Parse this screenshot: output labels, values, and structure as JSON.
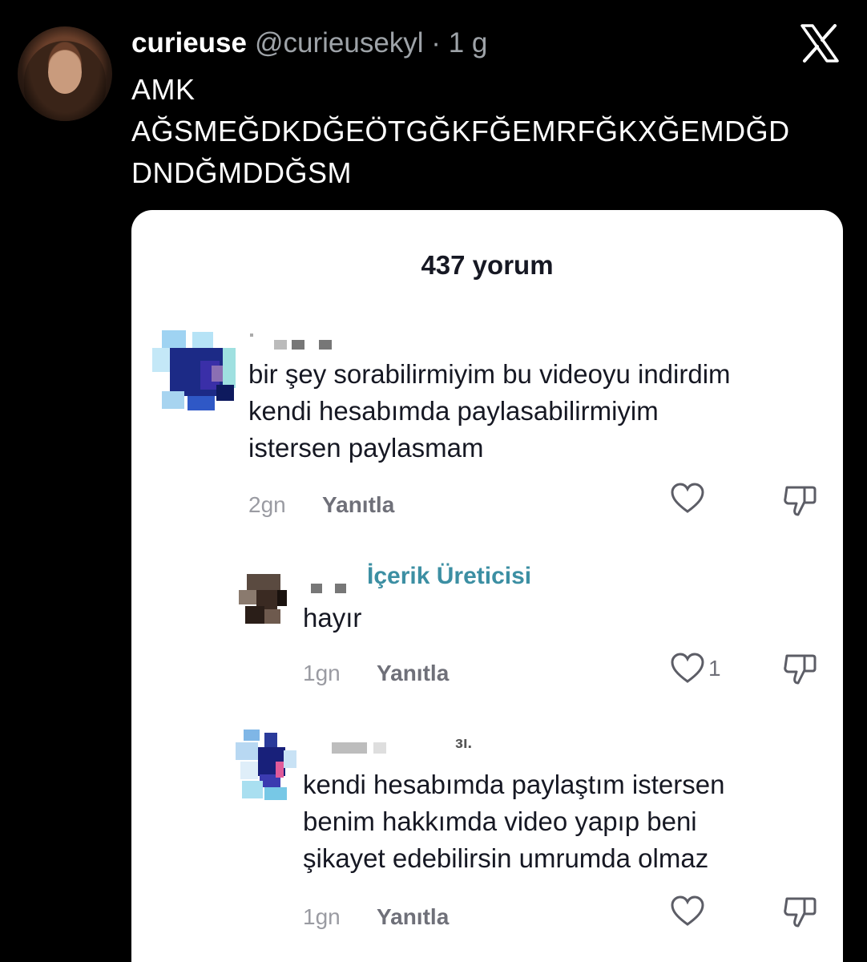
{
  "tweet": {
    "display_name": "curieuse",
    "handle": "@curieusekyl",
    "separator": " · ",
    "time": "1 g",
    "lines": [
      "AMK",
      "AĞSMEĞDKDĞEÖTGĞKFĞEMRFĞKXĞEMDĞD",
      "DNDĞMDDĞSM"
    ]
  },
  "comments_panel": {
    "title": "437 yorum",
    "comments": [
      {
        "text_lines": [
          "bir şey sorabilirmiyim bu videoyu indirdim",
          "kendi hesabımda paylasabilirmiyim",
          "istersen paylasmam"
        ],
        "time": "2gn",
        "reply_label": "Yanıtla"
      },
      {
        "badge": "İçerik Üreticisi",
        "text_lines": [
          "hayır"
        ],
        "time": "1gn",
        "reply_label": "Yanıtla",
        "like_count": "1"
      },
      {
        "username_fragment": "ɜı.",
        "text_lines": [
          "kendi hesabımda paylaştım istersen",
          "benim hakkımda video yapıp beni",
          "şikayet edebilirsin umrumda olmaz"
        ],
        "time": "1gn",
        "reply_label": "Yanıtla"
      }
    ]
  },
  "icons": {
    "brand": "x-logo-icon",
    "like": "heart-outline-icon",
    "dislike": "thumbs-down-icon"
  },
  "colors": {
    "background": "#000000",
    "card": "#ffffff",
    "secondary_text": "#9ea3a8",
    "creator_badge": "#3c8fa3"
  }
}
